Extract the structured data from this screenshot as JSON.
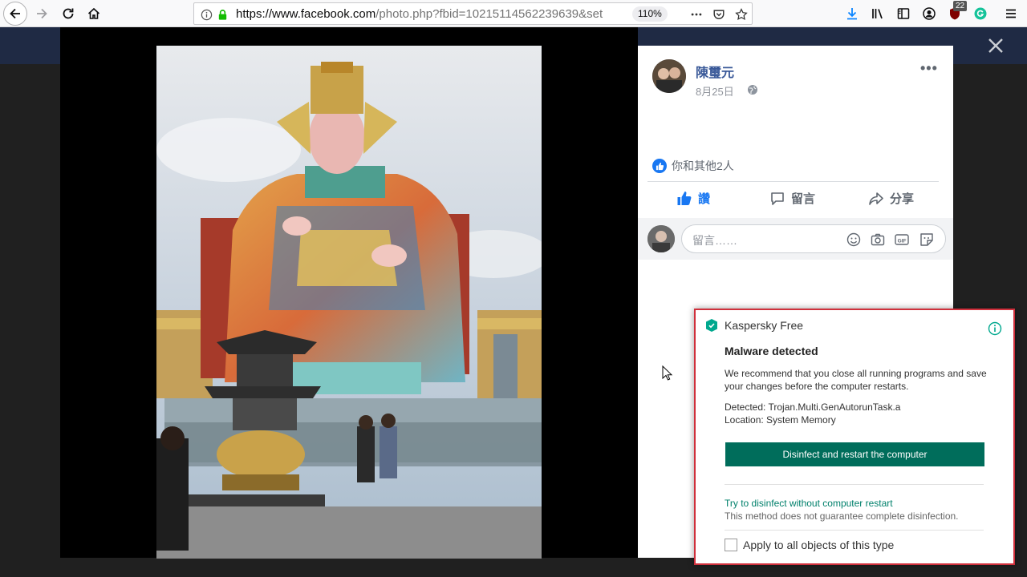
{
  "browser": {
    "url_base": "https://www.facebook.com",
    "url_rest": "/photo.php?fbid=10215114562239639&set",
    "zoom": "110%",
    "ublock_count": "22",
    "icons": [
      "back-arrow-icon",
      "forward-arrow-icon",
      "reload-icon",
      "home-icon",
      "info-icon",
      "lock-icon",
      "more-icon",
      "pocket-icon",
      "star-icon",
      "download-icon",
      "library-icon",
      "sidebar-icon",
      "account-icon",
      "ublock-icon",
      "grammarly-icon",
      "menu-icon"
    ]
  },
  "post": {
    "poster_name": "陳璽元",
    "date": "8月25日",
    "likes_text": "你和其他2人",
    "actions": {
      "like": "讚",
      "comment": "留言",
      "share": "分享"
    },
    "comment_placeholder": "留言……"
  },
  "kaspersky": {
    "product": "Kaspersky Free",
    "heading": "Malware detected",
    "body": "We recommend that you close all running programs and save your changes before the computer restarts.",
    "detected_label": "Detected:",
    "detected_value": "Trojan.Multi.GenAutorunTask.a",
    "location_label": "Location:",
    "location_value": "System Memory",
    "primary_button": "Disinfect and restart the computer",
    "alt_link": "Try to disinfect without computer restart",
    "alt_note": "This method does not guarantee complete disinfection.",
    "checkbox_label": "Apply to all objects of this type",
    "accent_color": "#006d5b",
    "alert_border_color": "#d0303c"
  }
}
